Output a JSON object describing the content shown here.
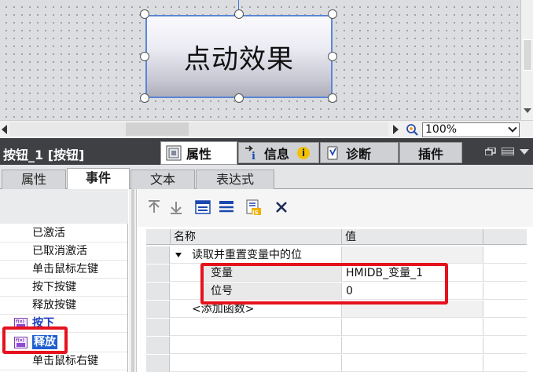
{
  "canvas": {
    "button_text": "点动效果"
  },
  "zoom": {
    "value": "100%"
  },
  "inspector": {
    "title": "按钮_1 [按钮]",
    "tabs": [
      {
        "label": "属性",
        "icon": "properties-icon"
      },
      {
        "label": "信息",
        "icon": "info-icon"
      },
      {
        "label": "诊断",
        "icon": "diagnostics-icon"
      },
      {
        "label": "插件",
        "icon": ""
      }
    ],
    "info_badge": "i"
  },
  "sub_tabs": [
    "属性",
    "事件",
    "文本",
    "表达式"
  ],
  "events": [
    {
      "label": "已激活"
    },
    {
      "label": "已取消激活"
    },
    {
      "label": "单击鼠标左键"
    },
    {
      "label": "按下按键"
    },
    {
      "label": "释放按键"
    },
    {
      "label": "按下"
    },
    {
      "label": "释放"
    },
    {
      "label": "单击鼠标右键"
    }
  ],
  "grid": {
    "headers": {
      "name": "名称",
      "value": "值"
    },
    "function_name": "读取并重置变量中的位",
    "params": [
      {
        "name": "变量",
        "value": "HMIDB_变量_1"
      },
      {
        "name": "位号",
        "value": "0"
      }
    ],
    "add_function": "<添加函数>"
  },
  "colors": {
    "highlight_red": "#e5121e",
    "selection_blue": "#1f5fd0",
    "header_dark": "#3e4043"
  }
}
